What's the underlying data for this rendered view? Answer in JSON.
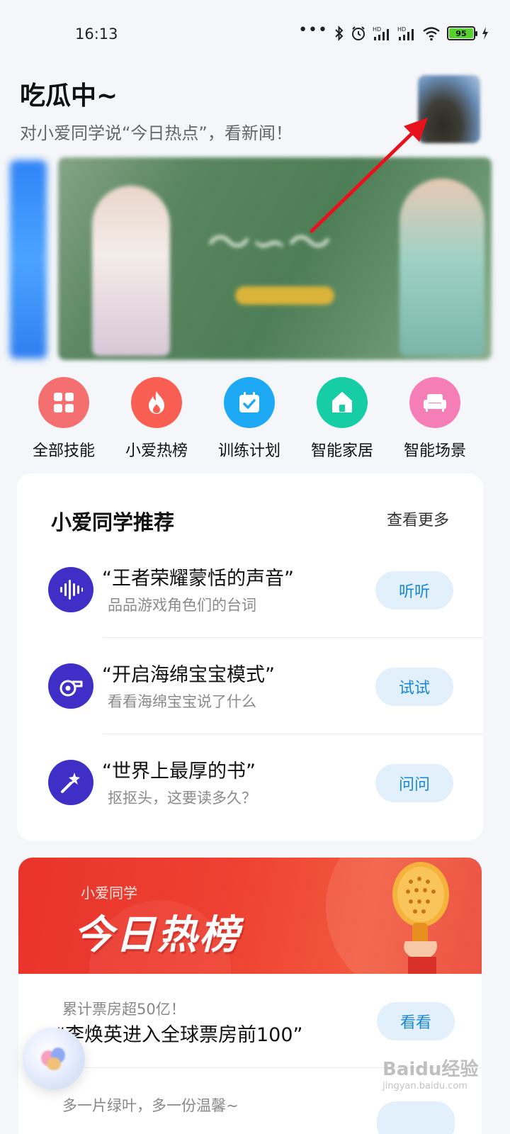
{
  "status_bar": {
    "time": "16:13",
    "battery": "95"
  },
  "header": {
    "title": "吃瓜中~",
    "subtitle": "对小爱同学说“今日热点”，看新闻！"
  },
  "skills": [
    {
      "label": "全部技能",
      "color": "#f46f6f",
      "icon": "grid-icon"
    },
    {
      "label": "小爱热榜",
      "color": "#f85e52",
      "icon": "flame-icon"
    },
    {
      "label": "训练计划",
      "color": "#1da8f3",
      "icon": "calendar-check-icon"
    },
    {
      "label": "智能家居",
      "color": "#16cda6",
      "icon": "home-icon"
    },
    {
      "label": "智能场景",
      "color": "#f57eb6",
      "icon": "sofa-icon"
    }
  ],
  "recommend": {
    "title": "小爱同学推荐",
    "more": "查看更多",
    "items": [
      {
        "title": "“王者荣耀蒙恬的声音”",
        "subtitle": "品品游戏角色们的台词",
        "button": "听听",
        "icon": "sound-wave-icon"
      },
      {
        "title": "“开启海绵宝宝模式”",
        "subtitle": "看看海绵宝宝说了什么",
        "button": "试试",
        "icon": "whistle-icon"
      },
      {
        "title": "“世界上最厚的书”",
        "subtitle": "抠抠头，这要读多久？",
        "button": "问问",
        "icon": "magic-wand-icon"
      }
    ]
  },
  "hot": {
    "small": "小爱同学",
    "big": "今日热榜",
    "items": [
      {
        "hint": "累计票房超50亿！",
        "title": "“李焕英进入全球票房前100”",
        "button": "看看"
      },
      {
        "hint": "多一片绿叶，多一份温馨~",
        "title": "",
        "button": ""
      }
    ]
  },
  "watermark": {
    "brand": "Baidu经验",
    "url": "jingyan.baidu.com"
  },
  "colors": {
    "accent_button_bg": "#e2f0fb",
    "accent_button_text": "#1a86d6",
    "rec_icon_bg": "#3f2fc6",
    "hot_banner": "#ee4132",
    "arrow": "#e8121c"
  }
}
